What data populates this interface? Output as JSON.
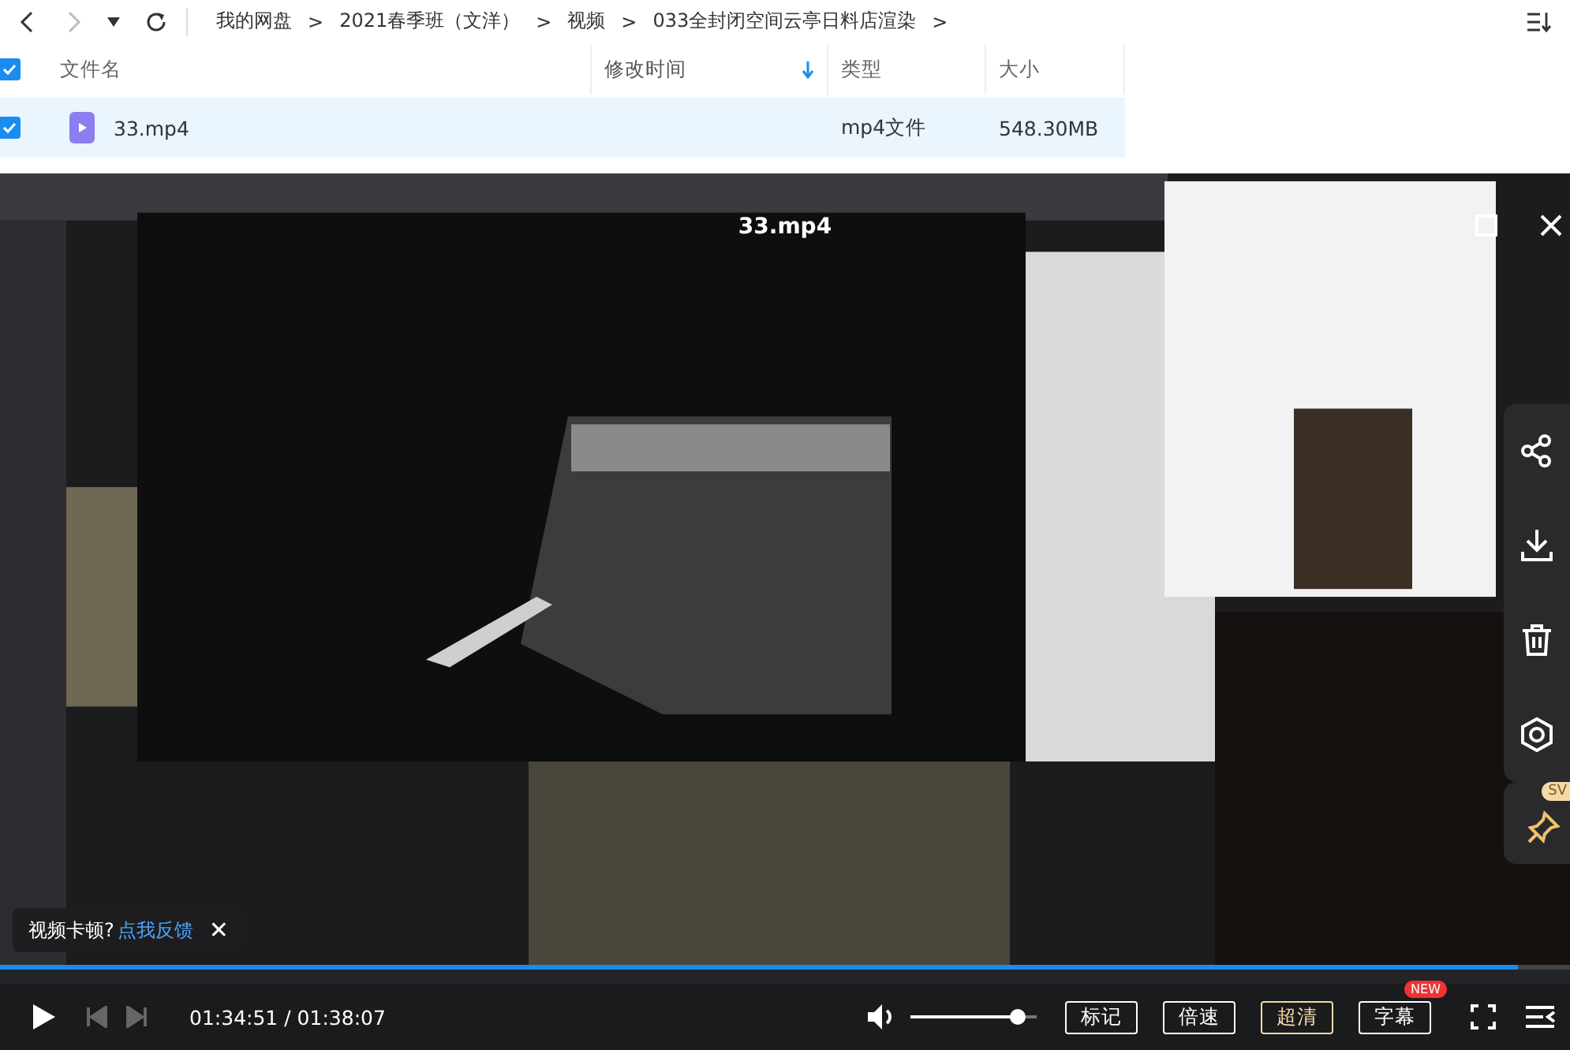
{
  "nav": {
    "back_disabled": false,
    "forward_disabled": true,
    "separator": ">",
    "breadcrumb": [
      "我的网盘",
      "2021春季班（文洋）",
      "视频",
      "033全封闭空间云亭日料店渲染"
    ]
  },
  "table": {
    "all_checked": true,
    "columns": [
      {
        "label": "文件名",
        "sorted": false
      },
      {
        "label": "修改时间",
        "sorted": true
      },
      {
        "label": "类型",
        "sorted": false
      },
      {
        "label": "大小",
        "sorted": false
      }
    ],
    "rows": [
      {
        "checked": true,
        "selected": true,
        "name": "33.mp4",
        "type": "mp4文件",
        "size": "548.30MB"
      }
    ]
  },
  "player": {
    "title": "33.mp4",
    "side_actions": [
      {
        "kind": "share"
      },
      {
        "kind": "download"
      },
      {
        "kind": "delete"
      },
      {
        "kind": "target"
      }
    ],
    "pin": {
      "badge": "SV"
    },
    "toast": {
      "text": "视频卡顿?",
      "link": "点我反馈",
      "close": "✕"
    },
    "progress": {
      "level": 0.967
    },
    "time": "01:34:51 / 01:38:07",
    "volume": {
      "level": 0.85
    },
    "buttons": [
      {
        "label": "标记",
        "highlight": false
      },
      {
        "label": "倍速",
        "highlight": false
      },
      {
        "label": "超清",
        "highlight": true
      },
      {
        "label": "字幕",
        "highlight": false,
        "badge": "NEW"
      }
    ]
  }
}
